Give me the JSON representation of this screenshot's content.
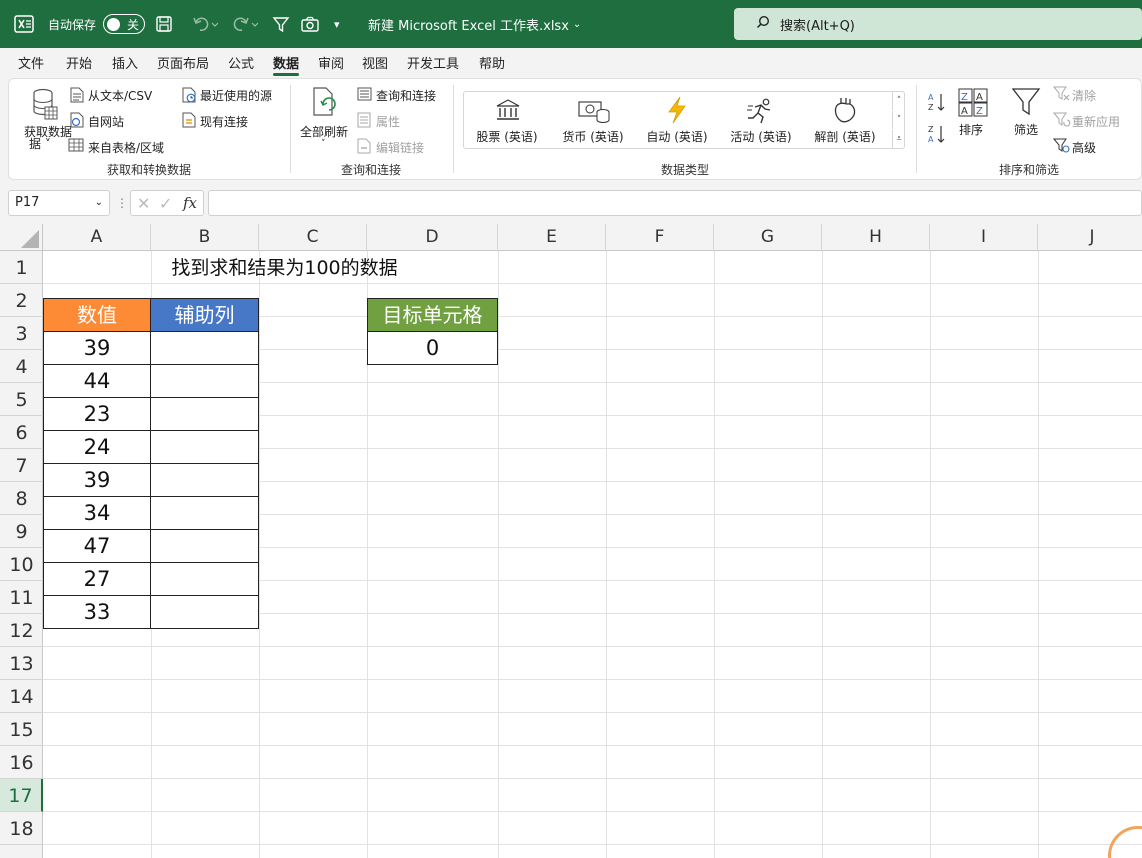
{
  "titlebar": {
    "autosave_label": "自动保存",
    "autosave_state": "关",
    "filename": "新建 Microsoft Excel 工作表.xlsx",
    "search_placeholder": "搜索(Alt+Q)"
  },
  "menu": {
    "items": [
      "文件",
      "开始",
      "插入",
      "页面布局",
      "公式",
      "数据",
      "审阅",
      "视图",
      "开发工具",
      "帮助"
    ],
    "active": "数据"
  },
  "ribbon": {
    "get_data": "获取数据",
    "from_text_csv": "从文本/CSV",
    "from_web": "自网站",
    "from_table": "来自表格/区域",
    "recent_sources": "最近使用的源",
    "existing_connections": "现有连接",
    "group_get_transform": "获取和转换数据",
    "refresh_all": "全部刷新",
    "queries_connections": "查询和连接",
    "properties": "属性",
    "edit_links": "编辑链接",
    "group_queries": "查询和连接",
    "data_types": [
      "股票 (英语)",
      "货币 (英语)",
      "自动 (英语)",
      "活动 (英语)",
      "解剖 (英语)"
    ],
    "group_data_types": "数据类型",
    "sort": "排序",
    "filter": "筛选",
    "clear": "清除",
    "reapply": "重新应用",
    "advanced": "高级",
    "group_sort_filter": "排序和筛选"
  },
  "formula_bar": {
    "name_box": "P17",
    "formula": ""
  },
  "sheet": {
    "columns": [
      "A",
      "B",
      "C",
      "D",
      "E",
      "F",
      "G",
      "H",
      "I",
      "J"
    ],
    "rows": [
      "1",
      "2",
      "3",
      "4",
      "5",
      "6",
      "7",
      "8",
      "9",
      "10",
      "11",
      "12",
      "13",
      "14",
      "15",
      "16",
      "17",
      "18"
    ],
    "selected_row": "17",
    "title": "找到求和结果为100的数据",
    "header_value": "数值",
    "header_helper": "辅助列",
    "values": [
      "39",
      "44",
      "23",
      "24",
      "39",
      "34",
      "47",
      "27",
      "33"
    ],
    "target_header": "目标单元格",
    "target_value": "0"
  },
  "colors": {
    "brand": "#1e6e3f",
    "header_orange": "#fd8a35",
    "header_blue": "#4778c8",
    "header_green": "#70a040"
  }
}
